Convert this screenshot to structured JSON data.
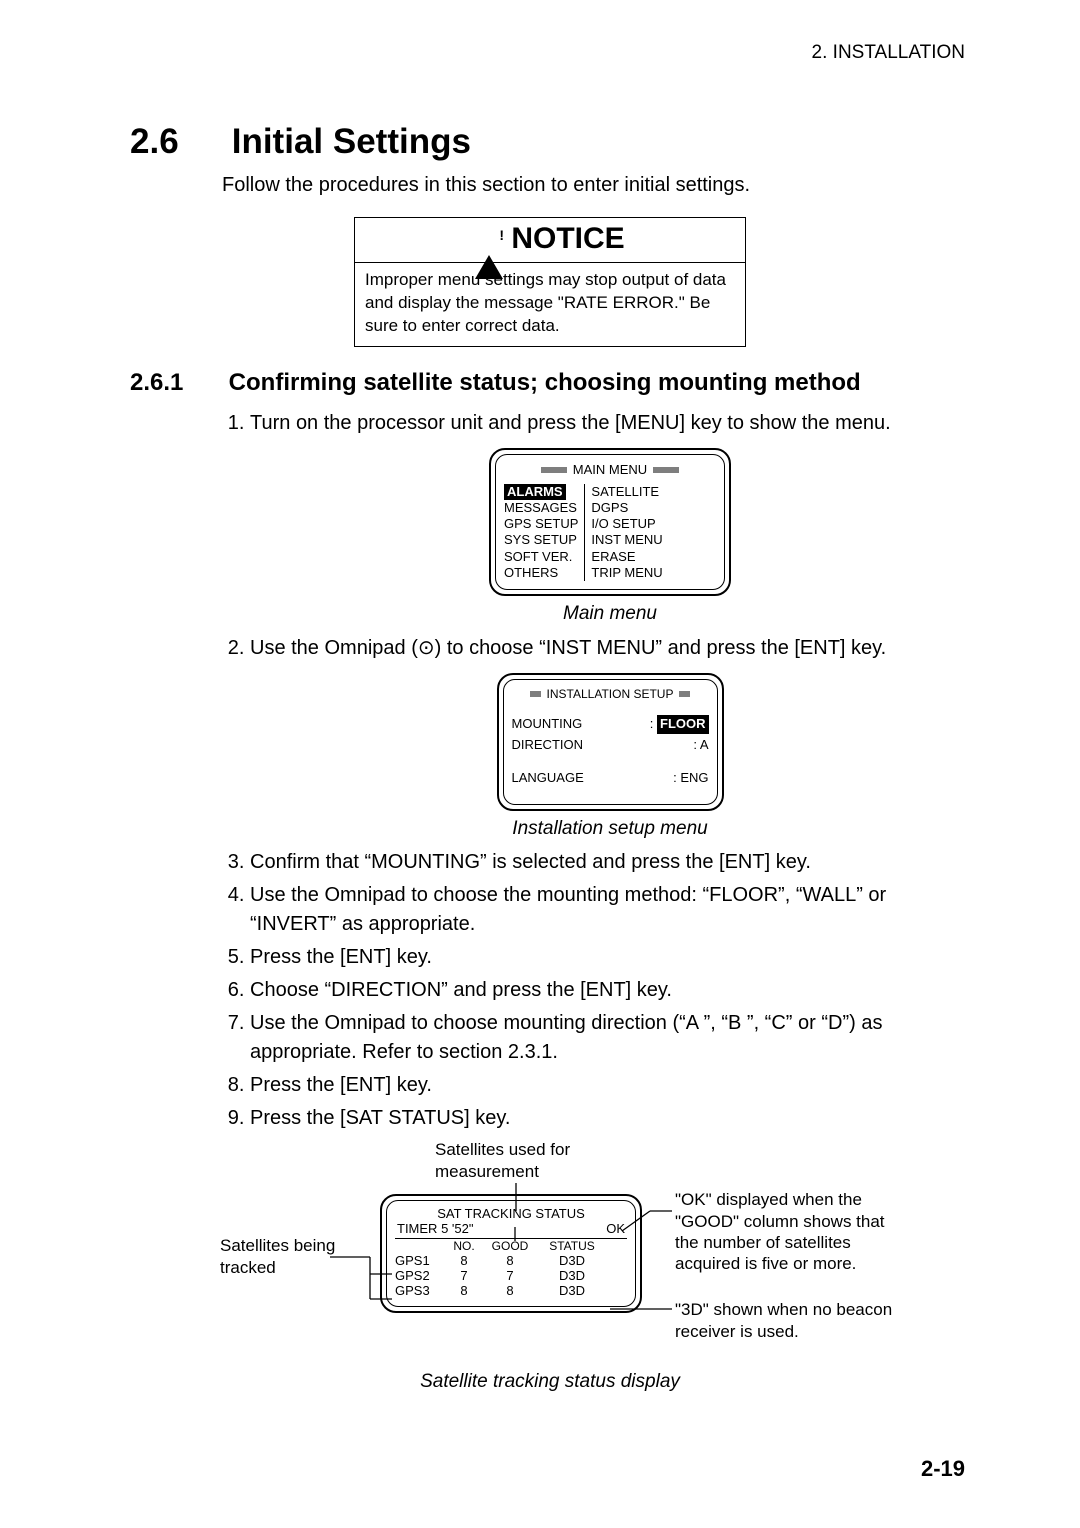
{
  "header": {
    "right": "2. INSTALLATION"
  },
  "section": {
    "num": "2.6",
    "title": "Initial Settings",
    "intro": "Follow the procedures in this section to enter initial settings."
  },
  "notice": {
    "heading": "NOTICE",
    "body": "Improper menu settings may stop output of data and display the message \"RATE ERROR.\" Be sure to enter correct data."
  },
  "subsection": {
    "num": "2.6.1",
    "title": "Confirming satellite status; choosing mounting method"
  },
  "steps": [
    "Turn on the processor unit and press the [MENU] key to show the menu.",
    "Use the Omnipad (⊙) to choose “INST MENU” and press the [ENT] key.",
    "Confirm that “MOUNTING” is selected and press the [ENT] key.",
    "Use the Omnipad to choose the mounting method: “FLOOR”, “WALL” or “INVERT” as appropriate.",
    "Press the [ENT] key.",
    "Choose “DIRECTION” and press the [ENT] key.",
    "Use the Omnipad to choose mounting direction (“A ”, “B ”, “C” or “D”) as appropriate. Refer to section 2.3.1.",
    "Press the [ENT] key.",
    "Press the [SAT STATUS] key."
  ],
  "main_menu": {
    "title": "MAIN MENU",
    "left": [
      "ALARMS",
      "MESSAGES",
      "GPS SETUP",
      "SYS SETUP",
      "SOFT VER.",
      "OTHERS"
    ],
    "right": [
      "SATELLITE",
      "DGPS",
      "I/O SETUP",
      "INST MENU",
      "ERASE",
      "TRIP MENU"
    ],
    "highlight_left_index": 0,
    "caption": "Main menu"
  },
  "install_menu": {
    "title": "INSTALLATION SETUP",
    "rows": [
      {
        "label": "MOUNTING",
        "value": "FLOOR",
        "highlighted": true
      },
      {
        "label": "DIRECTION",
        "value": "A",
        "highlighted": false
      },
      {
        "label": "LANGUAGE",
        "value": "ENG",
        "highlighted": false
      }
    ],
    "caption": "Installation setup menu"
  },
  "sat_figure": {
    "top_label": "Satellites used for measurement",
    "left_label": "Satellites being tracked",
    "right_label_1": "\"OK\" displayed when the \"GOOD\" column shows that the number of satellites acquired is five or more.",
    "right_label_2": "\"3D\" shown when no beacon receiver is used.",
    "lcd": {
      "title": "SAT TRACKING STATUS",
      "timer_label": "TIMER",
      "timer_value": "5 '52\"",
      "ok": "OK",
      "cols": [
        "",
        "NO.",
        "GOOD",
        "STATUS"
      ],
      "rows": [
        {
          "name": "GPS1",
          "no": "8",
          "good": "8",
          "status": "D3D"
        },
        {
          "name": "GPS2",
          "no": "7",
          "good": "7",
          "status": "D3D"
        },
        {
          "name": "GPS3",
          "no": "8",
          "good": "8",
          "status": "D3D"
        }
      ]
    },
    "caption": "Satellite tracking status display"
  },
  "page_number": "2-19"
}
